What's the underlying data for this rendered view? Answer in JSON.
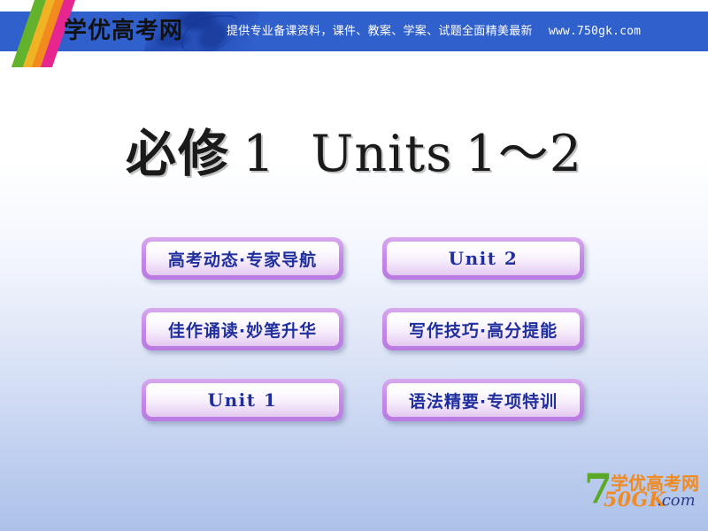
{
  "banner": {
    "logo_text": "学优高考网",
    "promo_text": "提供专业备课资料，课件、教案、学案、试题全面精美最新",
    "url": "www.750gk.com",
    "bar_color": "#3060cc",
    "stripe_colors": [
      "#62b32b",
      "#f0b323",
      "#f28b1e",
      "#e6258f"
    ]
  },
  "title": {
    "chinese": "必修",
    "book_number": "1",
    "english": "Units",
    "unit_range": "1～2"
  },
  "menu": {
    "buttons": [
      {
        "id": "gaokao-dynamics",
        "label": "高考动态·专家导航",
        "script": "cn",
        "col": "left",
        "row": 1
      },
      {
        "id": "unit-2",
        "label": "Unit  2",
        "script": "en",
        "col": "right",
        "row": 1
      },
      {
        "id": "recitation",
        "label": "佳作诵读·妙笔升华",
        "script": "cn",
        "col": "left",
        "row": 2
      },
      {
        "id": "writing-skills",
        "label": "写作技巧·高分提能",
        "script": "cn",
        "col": "right",
        "row": 2
      },
      {
        "id": "unit-1",
        "label": "Unit  1",
        "script": "en",
        "col": "left",
        "row": 3
      },
      {
        "id": "grammar",
        "label": "语法精要·专项特训",
        "script": "cn",
        "col": "right",
        "row": 3
      }
    ],
    "border_color": "#c88ae8",
    "label_color": "#1f2f9e"
  },
  "watermark": {
    "seven": "7",
    "chinese": "学优高考网",
    "code": "50GK",
    "tld": ".com",
    "green": "#5aa825",
    "orange": "#f08a22",
    "navy": "#2b3d8c"
  }
}
